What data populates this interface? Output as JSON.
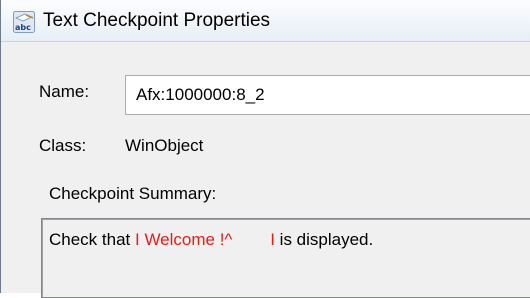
{
  "window": {
    "title": "Text Checkpoint Properties",
    "icon": "abc-text-icon"
  },
  "name_field": {
    "label": "Name:",
    "value": "Afx:1000000:8_2"
  },
  "class_field": {
    "label": "Class:",
    "value": "WinObject"
  },
  "summary": {
    "label": "Checkpoint Summary:",
    "prefix": "Check that ",
    "highlight_1": "I Welcome !^",
    "spacer": "        ",
    "highlight_2": "I",
    "suffix": " is displayed.",
    "highlight_color": "#e0201b"
  }
}
